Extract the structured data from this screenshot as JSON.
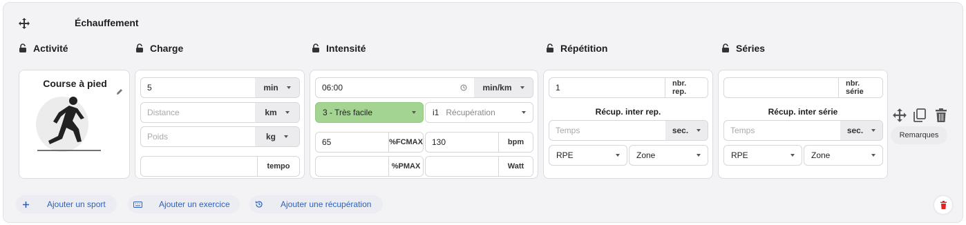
{
  "section": {
    "title": "Échauffement"
  },
  "columns": {
    "activite": "Activité",
    "charge": "Charge",
    "intensite": "Intensité",
    "repetition": "Répétition",
    "series": "Séries"
  },
  "activity": {
    "name": "Course à pied"
  },
  "charge": {
    "duration_value": "5",
    "duration_unit": "min",
    "distance_placeholder": "Distance",
    "distance_unit": "km",
    "weight_placeholder": "Poids",
    "weight_unit": "kg",
    "tempo_value": "",
    "tempo_label": "tempo"
  },
  "intensite": {
    "pace_value": "06:00",
    "pace_unit": "min/km",
    "level_selected": "3 - Très facile",
    "zone_prefix": "i1",
    "zone_placeholder": "Récupération",
    "fcmax_value": "65",
    "fcmax_label": "%FCMAX",
    "bpm_value": "130",
    "bpm_label": "bpm",
    "pmax_value": "",
    "pmax_label": "%PMAX",
    "watt_value": "",
    "watt_label": "Watt"
  },
  "repetition": {
    "count_value": "1",
    "count_label": "nbr. rep.",
    "recup_title": "Récup. inter rep.",
    "temps_placeholder": "Temps",
    "temps_unit": "sec.",
    "rpe_label": "RPE",
    "zone_label": "Zone"
  },
  "series": {
    "count_value": "",
    "count_label": "nbr. série",
    "recup_title": "Récup. inter série",
    "temps_placeholder": "Temps",
    "temps_unit": "sec.",
    "rpe_label": "RPE",
    "zone_label": "Zone"
  },
  "side_actions": {
    "remarques": "Remarques"
  },
  "buttons": {
    "add_sport": "Ajouter un sport",
    "add_exercise": "Ajouter un exercice",
    "add_recovery": "Ajouter une récupération"
  },
  "colors": {
    "accent_blue": "#2f5fb8",
    "easy_green": "#a3d491",
    "delete_red": "#e02424"
  }
}
